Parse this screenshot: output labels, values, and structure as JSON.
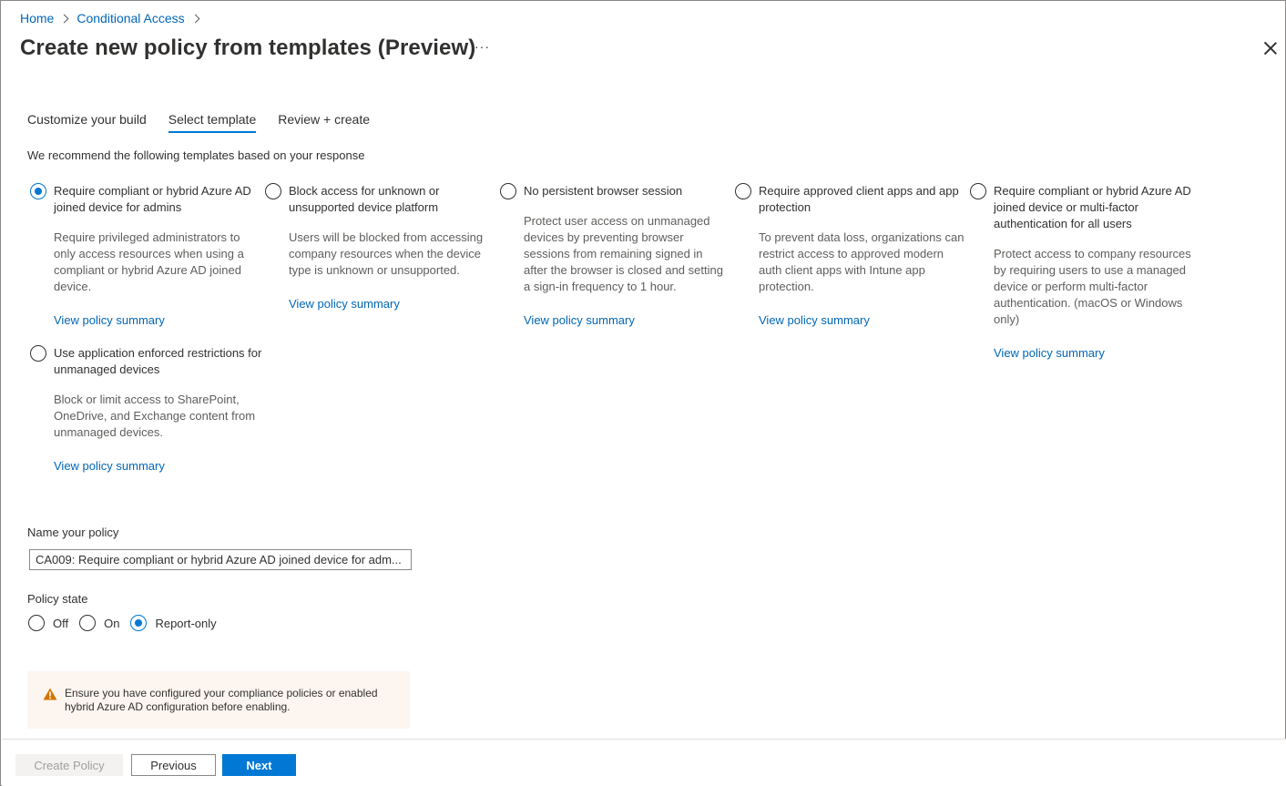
{
  "breadcrumb": {
    "home": "Home",
    "conditional_access": "Conditional Access"
  },
  "header": {
    "title": "Create new policy from templates (Preview)",
    "more": "···"
  },
  "tabs": [
    {
      "label": "Customize your build",
      "active": false
    },
    {
      "label": "Select template",
      "active": true
    },
    {
      "label": "Review + create",
      "active": false
    }
  ],
  "recommend_text": "We recommend the following templates based on your response",
  "templates": [
    {
      "title": "Require compliant or hybrid Azure AD joined device for admins",
      "description": "Require privileged administrators to only access resources when using a compliant or hybrid Azure AD joined device.",
      "link": "View policy summary",
      "selected": true
    },
    {
      "title": "Block access for unknown or unsupported device platform",
      "description": "Users will be blocked from accessing company resources when the device type is unknown or unsupported.",
      "link": "View policy summary",
      "selected": false
    },
    {
      "title": "No persistent browser session",
      "description": "Protect user access on unmanaged devices by preventing browser sessions from remaining signed in after the browser is closed and setting a sign-in frequency to 1 hour.",
      "link": "View policy summary",
      "selected": false
    },
    {
      "title": "Require approved client apps and app protection",
      "description": "To prevent data loss, organizations can restrict access to approved modern auth client apps with Intune app protection.",
      "link": "View policy summary",
      "selected": false
    },
    {
      "title": "Require compliant or hybrid Azure AD joined device or multi-factor authentication for all users",
      "description": "Protect access to company resources by requiring users to use a managed device or perform multi-factor authentication. (macOS or Windows only)",
      "link": "View policy summary",
      "selected": false
    },
    {
      "title": "Use application enforced restrictions for unmanaged devices",
      "description": "Block or limit access to SharePoint, OneDrive, and Exchange content from unmanaged devices.",
      "link": "View policy summary",
      "selected": false
    }
  ],
  "name_policy": {
    "label": "Name your policy",
    "value": "CA009: Require compliant or hybrid Azure AD joined device for adm..."
  },
  "policy_state": {
    "label": "Policy state",
    "options": [
      {
        "label": "Off",
        "selected": false
      },
      {
        "label": "On",
        "selected": false
      },
      {
        "label": "Report-only",
        "selected": true
      }
    ]
  },
  "warning": {
    "text": "Ensure you have configured your compliance policies or enabled hybrid Azure AD configuration before enabling.",
    "icon": "warning-icon"
  },
  "footer": {
    "create": "Create Policy",
    "previous": "Previous",
    "next": "Next"
  },
  "colors": {
    "accent": "#0078d4",
    "link": "#0067b8",
    "warning_bg": "#fdf6f0",
    "warning_icon": "#d47500"
  }
}
